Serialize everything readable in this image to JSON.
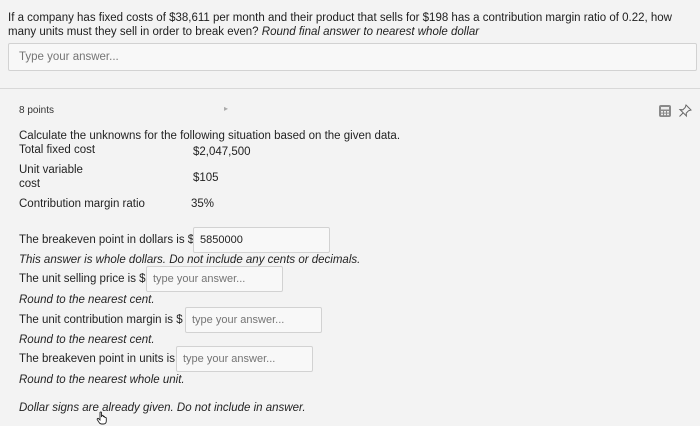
{
  "question1": {
    "text_a": "If a company has fixed costs of $38,611 per month and their product that sells for $198 has a contribution margin ratio of 0.22, how many units must they sell in order to break even? ",
    "text_b": "Round final answer to nearest whole dollar",
    "answer_placeholder": "Type your answer..."
  },
  "question2": {
    "points": "8 points",
    "title": "Calculate the unknowns for the following situation based on the given data.",
    "given": [
      {
        "label": "Total fixed cost",
        "value": "$2,047,500"
      },
      {
        "label": "Unit variable cost",
        "value": "$105"
      },
      {
        "label": "Contribution margin ratio",
        "value": "35%"
      }
    ],
    "unit_variable_label_line1": "Unit variable",
    "unit_variable_label_line2": "cost",
    "answers": {
      "breakeven_dollars_label": "The breakeven point in dollars is $",
      "breakeven_dollars_value": "5850000",
      "breakeven_dollars_note": "This answer is whole dollars. Do not include any cents or decimals.",
      "unit_price_label": "The unit selling price is $",
      "unit_price_placeholder": "type your answer...",
      "unit_price_note": "Round to the nearest cent.",
      "unit_cm_label": "The unit contribution margin is $",
      "unit_cm_placeholder": "type your answer...",
      "unit_cm_note": "Round to the nearest cent.",
      "breakeven_units_label": "The breakeven point in units is",
      "breakeven_units_placeholder": "type your answer...",
      "breakeven_units_note": "Round to the nearest whole unit."
    },
    "footer_note": "Dollar signs are already given. Do not include in answer."
  },
  "icons": [
    "calculator-icon",
    "pin-icon",
    "pointer-hand-icon"
  ]
}
